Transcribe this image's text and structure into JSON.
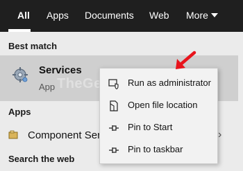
{
  "tabs": [
    {
      "label": "All",
      "active": true
    },
    {
      "label": "Apps"
    },
    {
      "label": "Documents"
    },
    {
      "label": "Web"
    },
    {
      "label": "More"
    }
  ],
  "sections": {
    "best_match": "Best match",
    "apps": "Apps",
    "search_web": "Search the web"
  },
  "best_match": {
    "title": "Services",
    "type": "App",
    "icon": "gear-services-icon"
  },
  "apps": [
    {
      "label": "Component Ser",
      "icon": "component-services-icon"
    }
  ],
  "watermark": "TheGeekPage.com",
  "context_menu": [
    {
      "label": "Run as administrator",
      "icon": "shield-admin-icon"
    },
    {
      "label": "Open file location",
      "icon": "file-location-icon"
    },
    {
      "label": "Pin to Start",
      "icon": "pin-icon"
    },
    {
      "label": "Pin to taskbar",
      "icon": "pin-icon"
    }
  ],
  "annotation": {
    "color": "#e8141c",
    "icon": "red-arrow-icon"
  },
  "colors": {
    "topbar": "#1f1f1f",
    "background": "#ebebeb",
    "selected_row": "#cfcfcf"
  }
}
